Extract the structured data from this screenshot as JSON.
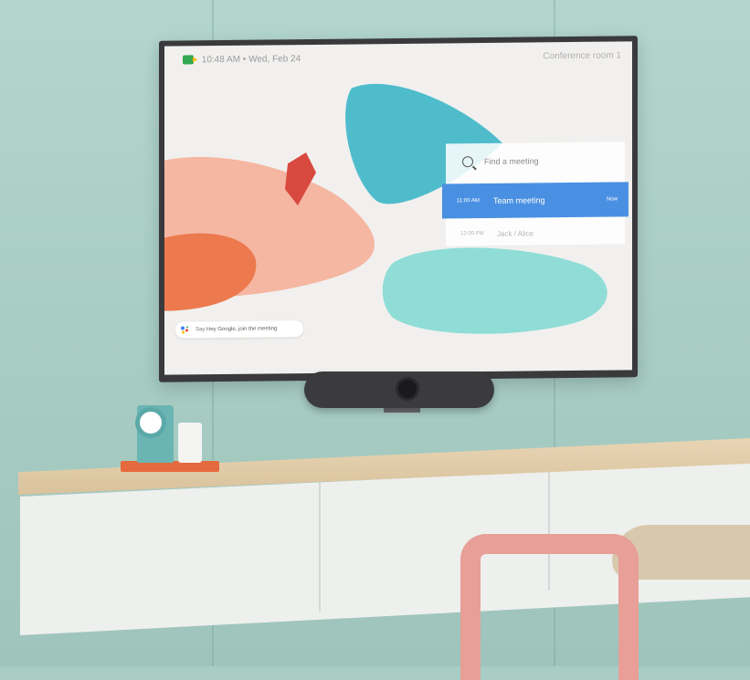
{
  "screen": {
    "status": "10:48 AM • Wed, Feb 24",
    "room": "Conference room 1",
    "search": {
      "placeholder": "Find a meeting"
    },
    "meetings": [
      {
        "time": "11:00 AM",
        "title": "Team meeting",
        "badge": "Now"
      },
      {
        "time": "12:00 PM",
        "title": "Jack / Alice"
      }
    ],
    "assistant": {
      "say": "Say ",
      "hint": "Hey Google, join the meeting"
    }
  },
  "colors": {
    "wall": "#a9cdc4",
    "accent_blue": "#4a90e2",
    "teal_blob": "#4fbccc",
    "mint_blob": "#8fddd6",
    "salmon_blob": "#f5b7a2",
    "orange_blob": "#ec7a4e",
    "chair_pink": "#e79f97",
    "tray_orange": "#e46a3e"
  },
  "icons": {
    "meet": "google-meet-icon",
    "search": "search-icon",
    "assistant": "google-assistant-icon"
  }
}
